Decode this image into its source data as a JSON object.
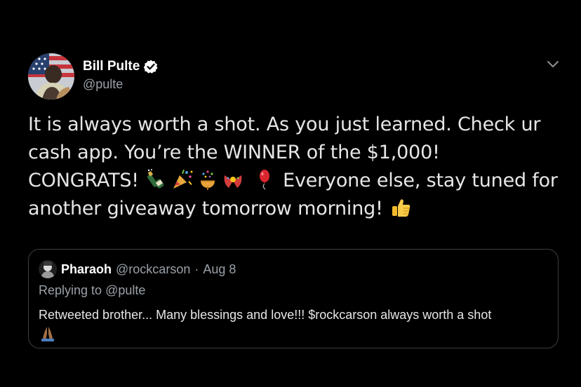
{
  "tweet": {
    "author": {
      "name": "Bill Pulte",
      "handle": "@pulte",
      "verified_icon": "verified-badge-icon"
    },
    "text_lines": [
      "It is always worth a shot. As you just learned. Check ur",
      "cash app. You’re the WINNER of the $1,000!",
      "CONGRATS!",
      "Everyone else, stay tuned for",
      "another giveaway tomorrow morning!"
    ],
    "emojis": [
      "champagne-bottle-icon",
      "party-popper-icon",
      "confetti-ball-icon",
      "wrapped-gift-icon",
      "balloon-icon",
      "thumbs-up-icon"
    ],
    "menu_icon": "chevron-down-icon"
  },
  "quoted": {
    "name": "Pharaoh",
    "handle": "@rockcarson",
    "separator": "·",
    "date": "Aug 8",
    "replying_prefix": "Replying to",
    "replying_to": "@pulte",
    "text": "Retweeted brother... Many blessings and love!!! $rockcarson always worth a shot",
    "emoji": "folded-hands-icon"
  },
  "colors": {
    "background": "#000000",
    "text": "#e6e6e6",
    "muted": "#9aa1a8",
    "border": "#3a3f44"
  }
}
